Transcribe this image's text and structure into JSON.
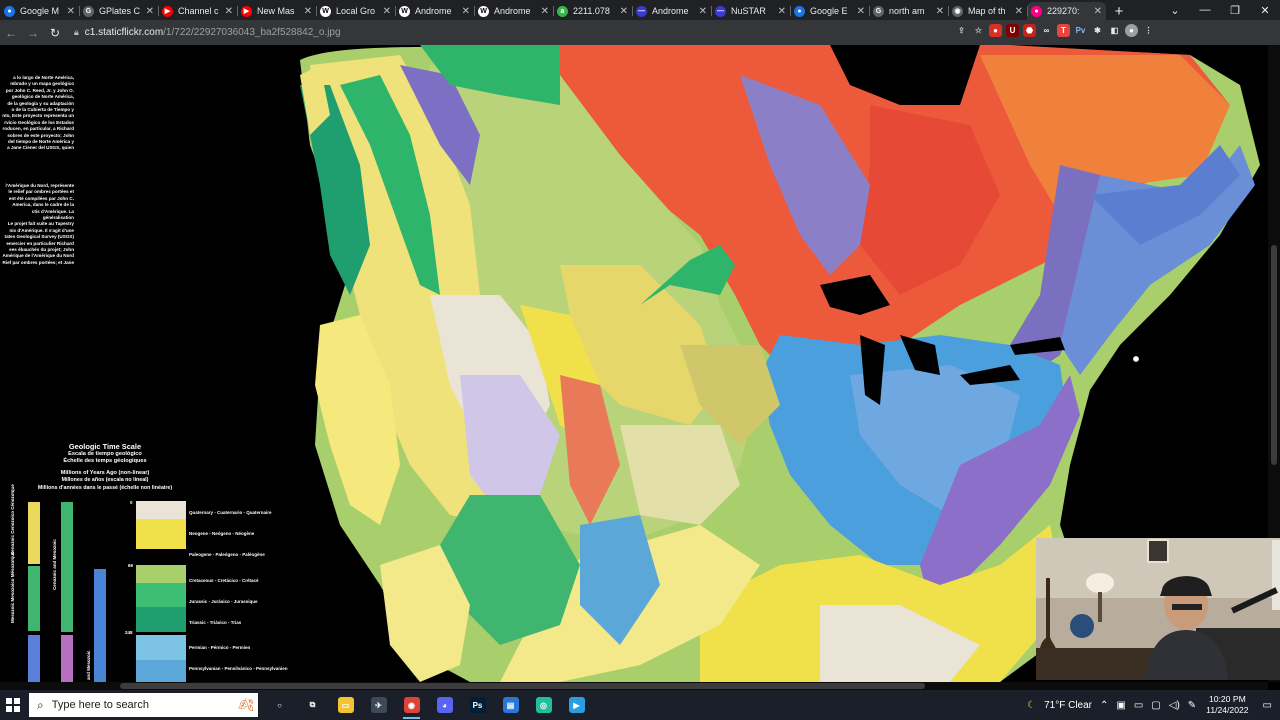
{
  "browser": {
    "tabs": [
      {
        "title": "Google M",
        "fav_color": "#1a73e8",
        "fav_glyph": "●"
      },
      {
        "title": "GPlates C",
        "fav_color": "#5f6368",
        "fav_glyph": "G"
      },
      {
        "title": "Channel c",
        "fav_color": "#ff0000",
        "fav_glyph": "▶"
      },
      {
        "title": "New Mas",
        "fav_color": "#ff0000",
        "fav_glyph": "▶"
      },
      {
        "title": "Local Gro",
        "fav_color": "#ffffff",
        "fav_glyph": "W"
      },
      {
        "title": "Androme",
        "fav_color": "#ffffff",
        "fav_glyph": "W"
      },
      {
        "title": "Androme",
        "fav_color": "#ffffff",
        "fav_glyph": "W"
      },
      {
        "title": "2211.078",
        "fav_color": "#39b54a",
        "fav_glyph": "a"
      },
      {
        "title": "Androme",
        "fav_color": "#3a3ad0",
        "fav_glyph": "—"
      },
      {
        "title": "NuSTAR",
        "fav_color": "#3a3ad0",
        "fav_glyph": "—"
      },
      {
        "title": "Google E",
        "fav_color": "#1a73e8",
        "fav_glyph": "●"
      },
      {
        "title": "north am",
        "fav_color": "#5f6368",
        "fav_glyph": "G"
      },
      {
        "title": "Map of th",
        "fav_color": "#5f6368",
        "fav_glyph": "◉"
      },
      {
        "title": "229270:",
        "fav_color": "#ff0084",
        "fav_glyph": "●"
      }
    ],
    "active_tab": 13,
    "new_tab_label": "+",
    "url_host": "c1.staticflickr.com",
    "url_path": "/1/722/22927036043_ba2f528842_o.jpg",
    "window_controls": [
      "⌄",
      "—",
      "❐",
      "✕"
    ]
  },
  "map": {
    "intro_paragraph_es": [
      "a lo largo de Norte América,",
      "mbrado y un mapa geológico",
      "por John C. Reed, Jr. y John O.",
      "geológico de Norte América,",
      "de la geología y su adaptación",
      "o de la Cubierta de Tiempo y",
      "nto, Este proyecto representa un",
      "rvicio Geológico de los Estados",
      "roducen, en particular, a Richard",
      "sobres de este proyecto; John",
      "del tiempo de Norte América y",
      "a Jane Ciener del USGS, quien"
    ],
    "intro_paragraph_fr": [
      "l'Amérique du Nord, représente",
      "le relief par ombres portées et",
      "ent été compilées par John C.",
      "America, dans le cadre de la",
      "ctis d'Amérique. La généralisation",
      "Le projet fait suite au Tapestry",
      "nis d'Amérique. Il s'agit d'une",
      "tates Geological Survey (USGS)",
      "emercier en particulier Richard",
      "ees ébauchés du projet; John",
      "Amérique de l'Amérique du Nord",
      "Rief par ombres portées; et Jane"
    ],
    "legend": {
      "title": "Geologic Time Scale",
      "subtitle_es": "Escala de tiempo geológico",
      "subtitle_fr": "Échelle des temps géologiques",
      "axis_en": "Millions of Years Ago (non-linear)",
      "axis_es": "Millones de años (escala no lineal)",
      "axis_fr": "Millions d'années dans le passé (échelle non linéaire)",
      "eras": [
        "Quaternary - Cuaternario - Quaternaire",
        "Neogene - Neógeno - Néogène",
        "Paleogene - Paleógeno - Paléogène",
        "Cretaceous - Cretácico - Crétacé",
        "Jurassic - Jurásico - Jurassique",
        "Triassic - Triásico - Trias",
        "Permian - Pérmico - Permien",
        "Pennsylvanian - Pensilvánico - Pennsylvanien"
      ],
      "ma_marks": [
        "0",
        "66",
        "248"
      ],
      "column_labels": [
        "Cenozoic Cenozoico Cénozoïque",
        "Mesozoic Mesozoico Mésozoïque",
        "Cenozoic and Mesozoic",
        "and Mesozoic"
      ],
      "colors": {
        "quaternary": "#e9e4d6",
        "neogene": "#f0e14a",
        "paleogene": "#d9c955",
        "cretaceous": "#a9cf6c",
        "jurassic": "#3dbf73",
        "triassic": "#1f9f6f",
        "permian": "#7cc3e6",
        "pennsylvanian": "#5aa7d8"
      }
    }
  },
  "taskbar": {
    "search_placeholder": "Type here to search",
    "search_icon": "search-icon",
    "weather": "71°F  Clear",
    "time": "10:20 PM",
    "date": "11/24/2022",
    "apps": [
      {
        "name": "cortana-icon",
        "color": "#1a1f29",
        "glyph": "○",
        "running": false
      },
      {
        "name": "task-view-icon",
        "color": "#1a1f29",
        "glyph": "⧉",
        "running": false
      },
      {
        "name": "file-explorer-icon",
        "color": "#f4c430",
        "glyph": "▭",
        "running": false
      },
      {
        "name": "app-icon",
        "color": "#3c4a5a",
        "glyph": "✈",
        "running": false
      },
      {
        "name": "chrome-icon",
        "color": "#db4437",
        "glyph": "◉",
        "running": true
      },
      {
        "name": "discord-icon",
        "color": "#5865f2",
        "glyph": "◕",
        "running": false
      },
      {
        "name": "photoshop-icon",
        "color": "#001e36",
        "glyph": "Ps",
        "running": false
      },
      {
        "name": "app-blue-icon",
        "color": "#2b77d8",
        "glyph": "▤",
        "running": false
      },
      {
        "name": "app-teal-icon",
        "color": "#1fbf9f",
        "glyph": "◎",
        "running": false
      },
      {
        "name": "app-lightblue-icon",
        "color": "#2a9fe0",
        "glyph": "▶",
        "running": false
      }
    ]
  }
}
